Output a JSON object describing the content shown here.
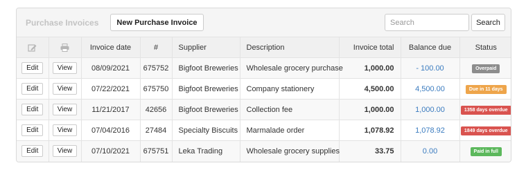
{
  "toolbar": {
    "title": "Purchase Invoices",
    "new_invoice_label": "New Purchase Invoice",
    "search_placeholder": "Search",
    "search_button_label": "Search"
  },
  "table": {
    "header_icons": [
      "edit-icon",
      "print-icon"
    ],
    "headers": {
      "invoice_date": "Invoice date",
      "number": "#",
      "supplier": "Supplier",
      "description": "Description",
      "invoice_total": "Invoice total",
      "balance_due": "Balance due",
      "status": "Status"
    },
    "edit_label": "Edit",
    "view_label": "View",
    "rows": [
      {
        "date": "08/09/2021",
        "number": "675752",
        "supplier": "Bigfoot Breweries",
        "description": "Wholesale grocery purchase",
        "total": "1,000.00",
        "balance": "- 100.00",
        "status": "Overpaid",
        "status_color": "#8d8d8d"
      },
      {
        "date": "07/22/2021",
        "number": "675750",
        "supplier": "Bigfoot Breweries",
        "description": "Company stationery",
        "total": "4,500.00",
        "balance": "4,500.00",
        "status": "Due in 11 days",
        "status_color": "#eea54b"
      },
      {
        "date": "11/21/2017",
        "number": "42656",
        "supplier": "Bigfoot Breweries",
        "description": "Collection fee",
        "total": "1,000.00",
        "balance": "1,000.00",
        "status": "1358 days overdue",
        "status_color": "#d9534f"
      },
      {
        "date": "07/04/2016",
        "number": "27484",
        "supplier": "Specialty Biscuits",
        "description": "Marmalade order",
        "total": "1,078.92",
        "balance": "1,078.92",
        "status": "1849 days overdue",
        "status_color": "#d9534f"
      },
      {
        "date": "07/10/2021",
        "number": "675751",
        "supplier": "Leka Trading",
        "description": "Wholesale grocery supplies",
        "total": "33.75",
        "balance": "0.00",
        "status": "Paid in full",
        "status_color": "#5cb85c"
      }
    ]
  },
  "colors": {
    "balance_link": "#3a7bbf",
    "title_muted": "#c3c3c3"
  }
}
